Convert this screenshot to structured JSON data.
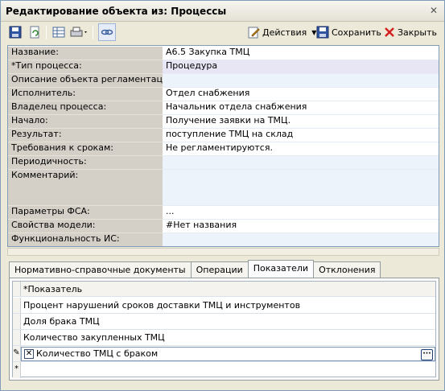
{
  "window": {
    "title": "Редактирование объекта из: Процессы",
    "close_label": "✕"
  },
  "toolbar": {
    "actions_label": "Действия",
    "save_label": "Сохранить",
    "close_label": "Закрыть"
  },
  "properties": [
    {
      "label": "Название:",
      "value": "А6.5 Закупка ТМЦ"
    },
    {
      "label": "*Тип процесса:",
      "value": "Процедура"
    },
    {
      "label": "Описание объекта регламентации:",
      "value": ""
    },
    {
      "label": "Исполнитель:",
      "value": "Отдел снабжения"
    },
    {
      "label": "Владелец процесса:",
      "value": "Начальник отдела снабжения"
    },
    {
      "label": "Начало:",
      "value": "Получение заявки на ТМЦ."
    },
    {
      "label": "Результат:",
      "value": "поступление ТМЦ на склад"
    },
    {
      "label": "Требования к срокам:",
      "value": "Не регламентируются."
    },
    {
      "label": "Периодичность:",
      "value": ""
    },
    {
      "label": "Комментарий:",
      "value": ""
    },
    {
      "label": "Параметры ФСА:",
      "value": "..."
    },
    {
      "label": "Свойства модели:",
      "value": "#Нет названия"
    },
    {
      "label": "Функциональность ИС:",
      "value": ""
    }
  ],
  "tabs": [
    {
      "label": "Нормативно-справочные документы"
    },
    {
      "label": "Операции"
    },
    {
      "label": "Показатели"
    },
    {
      "label": "Отклонения"
    }
  ],
  "grid": {
    "header": "*Показатель",
    "rows": [
      "Процент нарушений сроков доставки ТМЦ и инструментов",
      "Доля брака ТМЦ",
      "Количество закупленных ТМЦ",
      "Количество ТМЦ с браком"
    ],
    "editing_marker": "✎",
    "new_row_marker": "*",
    "ellipsis_label": "···"
  },
  "colors": {
    "title_bg": "#e4e2d6",
    "label_bg": "#d4d0c8",
    "value_bg": "#edf3fa",
    "selected_bg": "#e8e6f5"
  }
}
